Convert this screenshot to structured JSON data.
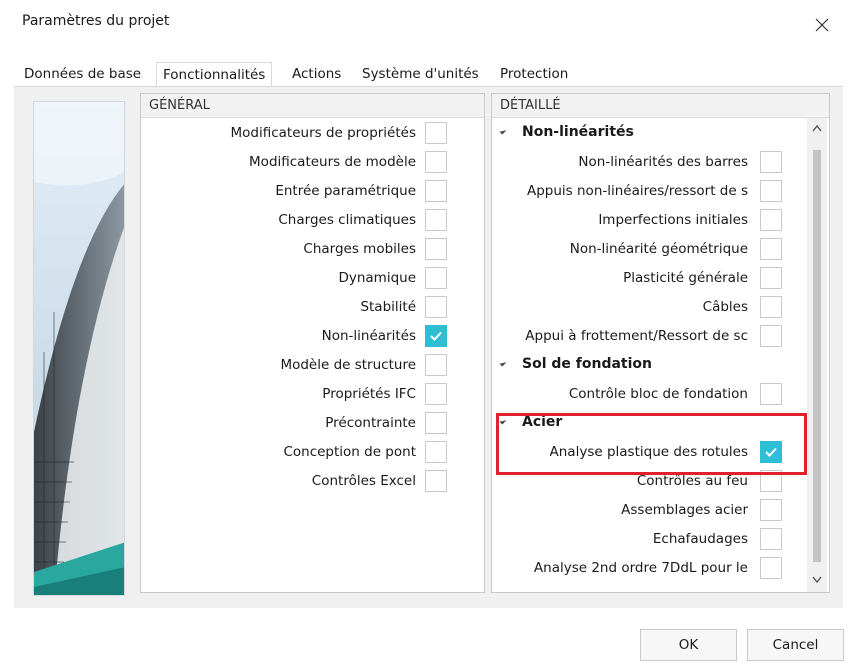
{
  "window": {
    "title": "Paramètres du projet",
    "close_glyph": "✕"
  },
  "tabs": [
    {
      "label": "Données de base",
      "active": false
    },
    {
      "label": "Fonctionnalités",
      "active": true
    },
    {
      "label": "Actions",
      "active": false
    },
    {
      "label": "Système d'unités",
      "active": false
    },
    {
      "label": "Protection",
      "active": false
    }
  ],
  "general": {
    "header": "GÉNÉRAL",
    "items": [
      {
        "label": "Modificateurs de propriétés",
        "checked": false
      },
      {
        "label": "Modificateurs de modèle",
        "checked": false
      },
      {
        "label": "Entrée paramétrique",
        "checked": false
      },
      {
        "label": "Charges climatiques",
        "checked": false
      },
      {
        "label": "Charges mobiles",
        "checked": false
      },
      {
        "label": "Dynamique",
        "checked": false
      },
      {
        "label": "Stabilité",
        "checked": false
      },
      {
        "label": "Non-linéarités",
        "checked": true
      },
      {
        "label": "Modèle de structure",
        "checked": false
      },
      {
        "label": "Propriétés IFC",
        "checked": false
      },
      {
        "label": "Précontrainte",
        "checked": false
      },
      {
        "label": "Conception de pont",
        "checked": false
      },
      {
        "label": "Contrôles Excel",
        "checked": false
      }
    ]
  },
  "detail": {
    "header": "DÉTAILLÉ",
    "groups": [
      {
        "label": "Non-linéarités",
        "items": [
          {
            "label": "Non-linéarités des barres",
            "checked": false
          },
          {
            "label": "Appuis non-linéaires/ressort de s",
            "checked": false
          },
          {
            "label": "Imperfections initiales",
            "checked": false
          },
          {
            "label": "Non-linéarité géométrique",
            "checked": false
          },
          {
            "label": "Plasticité générale",
            "checked": false
          },
          {
            "label": "Câbles",
            "checked": false
          },
          {
            "label": "Appui à frottement/Ressort de sc",
            "checked": false
          }
        ]
      },
      {
        "label": "Sol de fondation",
        "items": [
          {
            "label": "Contrôle bloc de fondation",
            "checked": false
          }
        ]
      },
      {
        "label": "Acier",
        "items": [
          {
            "label": "Analyse plastique des rotules",
            "checked": true
          },
          {
            "label": "Contrôles au feu",
            "checked": false
          },
          {
            "label": "Assemblages acier",
            "checked": false
          },
          {
            "label": "Echafaudages",
            "checked": false
          },
          {
            "label": "Analyse 2nd ordre 7DdL pour le",
            "checked": false
          }
        ]
      }
    ]
  },
  "buttons": {
    "ok": "OK",
    "cancel": "Cancel"
  },
  "colors": {
    "accent_check": "#2fbfd4",
    "highlight_box": "#e0202c"
  }
}
